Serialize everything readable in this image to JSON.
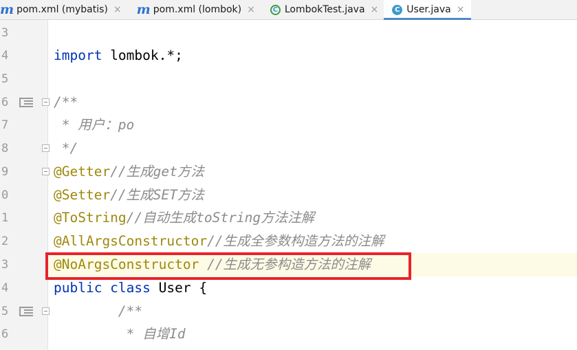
{
  "tabs": [
    {
      "icon": "m",
      "label": "pom.xml (mybatis)"
    },
    {
      "icon": "m",
      "label": "pom.xml (lombok)"
    },
    {
      "icon": "c",
      "label": "LombokTest.java"
    },
    {
      "icon": "c",
      "label": "User.java",
      "active": true
    }
  ],
  "close_glyph": "×",
  "editor": {
    "lines": [
      {
        "num": "3",
        "text": ""
      },
      {
        "num": "4",
        "kw": "import",
        "text": " lombok.*;"
      },
      {
        "num": "5",
        "text": ""
      },
      {
        "num": "6",
        "comment": "/**"
      },
      {
        "num": "7",
        "comment": " * 用户：po"
      },
      {
        "num": "8",
        "comment": " */"
      },
      {
        "num": "9",
        "ann": "@Getter",
        "comment": "//生成get方法"
      },
      {
        "num": "0",
        "ann": "@Setter",
        "comment": "//生成SET方法"
      },
      {
        "num": "1",
        "ann": "@ToString",
        "comment": "//自动生成toString方法注解"
      },
      {
        "num": "2",
        "ann": "@AllArgsConstructor",
        "comment": "//生成全参数构造方法的注解"
      },
      {
        "num": "3",
        "ann": "@NoArgsConstructor",
        "comment": " //生成无参构造方法的注解"
      },
      {
        "num": "4",
        "kw": "public class",
        "text": " User {"
      },
      {
        "num": "5",
        "comment": "        /**"
      },
      {
        "num": "6",
        "comment": "         * 自增Id"
      }
    ]
  },
  "colors": {
    "keyword": "#0033b3",
    "annotation": "#9e880d",
    "comment": "#8c8c8c",
    "highlight_box": "#e8232a",
    "maven_icon": "#2f6fce",
    "class_icon": "#3d9bd0"
  }
}
